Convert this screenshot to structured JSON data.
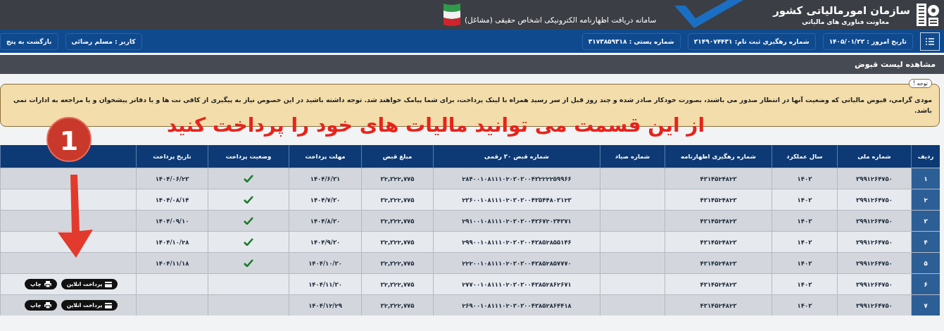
{
  "header": {
    "org_title": "سازمان امورمالیاتی کشور",
    "org_subtitle": "معاونت فناوری های مالیاتی",
    "system_title": "سامانه دریافت اظهارنامه الکترونیکی اشخاص حقیقی (مشاغل)"
  },
  "navbar": {
    "today": "تاریخ امروز : ۱۴۰۵/۰۱/۲۲",
    "registration": "شماره رهگیری ثبت نام: ۲۱۴۹۰۷۴۴۳۱",
    "postal": "شماره پستی : ۳۱۷۳۸۵۹۳۱۸",
    "user": "کاربر : مسلم رضائی",
    "back_button": "بازگشت به پنج"
  },
  "page_title": "مشاهده لیست قبوض",
  "notice": {
    "legend": "توجه !",
    "text": "مودی گرامی، قبوض مالیاتی که وضعیت آنها در انتظار صدور می باشند، بصورت خودکار صادر شده و چند روز قبل از سر رسید همراه با لینک پرداخت، برای شما پیامک خواهند شد. توجه داشته باشید در این خصوص نیاز به پیگیری از کافی نت ها و یا دفاتر پیشخوان و یا مراجعه به ادارات نمی باشد."
  },
  "annotation": {
    "text": "از این قسمت می توانید مالیات های خود را پرداخت کنید",
    "step": "1"
  },
  "table": {
    "columns": [
      "ردیف",
      "شماره ملی",
      "سال عملکرد",
      "شماره رهگیری اظهارنامه",
      "شماره صیاد",
      "شماره قبض ۳۰ رقمی",
      "مبلغ قبض",
      "مهلت پرداخت",
      "وضعیت پرداخت",
      "تاریخ پرداخت"
    ],
    "rows": [
      {
        "row_no": "۱",
        "national_id": "۳۹۹۱۲۶۴۷۵۰",
        "year": "۱۴۰۳",
        "tracking": "۴۳۱۴۵۲۴۸۲۳",
        "bill_no": "۲۸۴۰۰۱۰۸۱۱۱۰۲۰۳۰۳۰۰۴۳۲۲۲۲۵۹۹۶۶",
        "amount": "۳۲,۳۲۲,۷۷۵",
        "deadline": "۱۴۰۴/۶/۳۱",
        "paid": true,
        "payment_date": "۱۴۰۴/۰۶/۲۳"
      },
      {
        "row_no": "۲",
        "national_id": "۳۹۹۱۲۶۴۷۵۰",
        "year": "۱۴۰۳",
        "tracking": "۴۳۱۴۵۲۴۸۲۳",
        "bill_no": "۲۳۶۰۰۱۰۸۱۱۱۰۲۰۳۰۳۰۰۴۳۵۴۴۸۰۳۱۲۳",
        "amount": "۳۲,۳۲۲,۷۷۵",
        "deadline": "۱۴۰۴/۷/۳۰",
        "paid": true,
        "payment_date": "۱۴۰۴/۰۸/۱۴"
      },
      {
        "row_no": "۳",
        "national_id": "۳۹۹۱۲۶۴۷۵۰",
        "year": "۱۴۰۳",
        "tracking": "۴۳۱۴۵۲۴۸۲۳",
        "bill_no": "۲۹۱۰۰۱۰۸۱۱۱۰۲۰۳۰۳۰۰۴۳۶۷۲۰۳۴۳۷۱",
        "amount": "۳۲,۳۲۲,۷۷۵",
        "deadline": "۱۴۰۴/۸/۳۰",
        "paid": true,
        "payment_date": "۱۴۰۴/۰۹/۱۰"
      },
      {
        "row_no": "۴",
        "national_id": "۳۹۹۱۲۶۴۷۵۰",
        "year": "۱۴۰۳",
        "tracking": "۴۳۱۴۵۲۴۸۲۳",
        "bill_no": "۲۹۹۰۰۱۰۸۱۱۱۰۲۰۳۰۳۰۰۴۳۸۵۲۸۵۵۱۴۶",
        "amount": "۳۲,۳۲۲,۷۷۵",
        "deadline": "۱۴۰۴/۹/۳۰",
        "paid": true,
        "payment_date": "۱۴۰۴/۱۰/۲۸"
      },
      {
        "row_no": "۵",
        "national_id": "۳۹۹۱۲۶۴۷۵۰",
        "year": "۱۴۰۳",
        "tracking": "۴۳۱۴۵۲۴۸۲۳",
        "bill_no": "۲۲۲۰۰۱۰۸۱۱۱۰۲۰۳۰۳۰۰۴۳۸۵۲۸۵۷۷۷۰",
        "amount": "۳۲,۳۲۲,۷۷۵",
        "deadline": "۱۴۰۴/۱۰/۳۰",
        "paid": true,
        "payment_date": "۱۴۰۴/۱۱/۱۸"
      },
      {
        "row_no": "۶",
        "national_id": "۳۹۹۱۲۶۴۷۵۰",
        "year": "۱۴۰۳",
        "tracking": "۴۳۱۴۵۲۴۸۲۳",
        "bill_no": "۲۷۷۰۰۱۰۸۱۱۱۰۲۰۳۰۳۰۰۴۳۸۵۲۸۶۲۶۷۱",
        "amount": "۳۲,۳۲۲,۷۷۵",
        "deadline": "۱۴۰۴/۱۱/۳۰",
        "paid": false,
        "actions": [
          {
            "kind": "pay",
            "label": "پرداخت انلاین"
          },
          {
            "kind": "print",
            "label": "چاپ"
          }
        ]
      },
      {
        "row_no": "۷",
        "national_id": "۳۹۹۱۲۶۴۷۵۰",
        "year": "۱۴۰۳",
        "tracking": "۴۳۱۴۵۲۴۸۲۳",
        "bill_no": "۲۶۹۰۰۱۰۸۱۱۱۰۲۰۳۰۳۰۰۴۳۸۵۲۸۶۴۴۱۸",
        "amount": "۳۲,۳۲۲,۷۷۵",
        "deadline": "۱۴۰۴/۱۲/۲۹",
        "paid": false,
        "actions": [
          {
            "kind": "pay",
            "label": "پرداخت انلاین"
          },
          {
            "kind": "print",
            "label": "چاپ"
          }
        ]
      }
    ]
  }
}
